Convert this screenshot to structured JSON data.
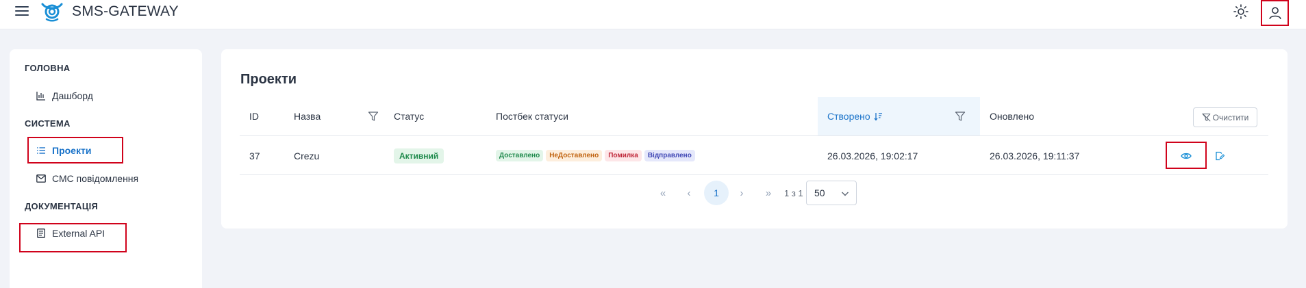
{
  "header": {
    "app_title": "SMS-GATEWAY",
    "menu_icon": "hamburger-icon",
    "logo": "satellite-logo",
    "theme_icon": "sun-icon",
    "user_icon": "user-icon"
  },
  "sidebar": {
    "sections": [
      {
        "title": "ГОЛОВНА",
        "items": [
          {
            "label": "Дашборд",
            "icon": "bar-chart-icon"
          }
        ]
      },
      {
        "title": "СИСТЕМА",
        "items": [
          {
            "label": "Проекти",
            "icon": "list-icon",
            "active": true
          },
          {
            "label": "СМС повідомлення",
            "icon": "mail-icon"
          }
        ]
      },
      {
        "title": "ДОКУМЕНТАЦІЯ",
        "items": [
          {
            "label": "External API",
            "icon": "document-icon"
          }
        ]
      }
    ]
  },
  "main": {
    "title": "Проекти",
    "clear_button": "Очистити",
    "columns": {
      "id": "ID",
      "name": "Назва",
      "status": "Статус",
      "postback": "Постбек статуси",
      "created": "Створено",
      "updated": "Оновлено"
    },
    "rows": [
      {
        "id": "37",
        "name": "Crezu",
        "status": "Активний",
        "postback_tags": [
          "Доставлено",
          "НеДоставлено",
          "Помилка",
          "Відправлено"
        ],
        "created": "26.03.2026, 19:02:17",
        "updated": "26.03.2026, 19:11:37"
      }
    ],
    "pagination": {
      "first": "«",
      "prev": "‹",
      "current_page": "1",
      "next": "›",
      "last": "»",
      "info": "1 з 1",
      "page_size": "50"
    }
  },
  "colors": {
    "accent": "#1a73c9",
    "highlight_border": "#d0021b",
    "status_active": "#1f8a4c"
  }
}
